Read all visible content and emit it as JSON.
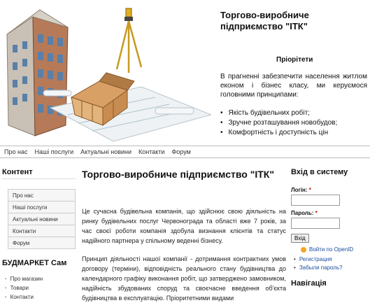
{
  "header": {
    "brand": "Торгово-виробниче підприємство \"ІТК\"",
    "priorities_title": "Пріорітети",
    "priorities_text": "В прагненні забезпечити населення житлом економ і бізнес класу, ми керуємося головними принципами:",
    "priorities": [
      "Якість будівельних робіт;",
      "Зручне розташування новобудов;",
      "Комфортність і доступність цін"
    ]
  },
  "nav": {
    "items": [
      "Про нас",
      "Наші послуги",
      "Актуальні новини",
      "Контакти",
      "Форум"
    ]
  },
  "left": {
    "content_title": "Контент",
    "menu": [
      "Про нас",
      "Наші послуги",
      "Актуальні новини",
      "Контакти",
      "Форум"
    ],
    "shop_title": "БУДМАРКЕТ Сам",
    "shop_items": [
      "Про магазин",
      "Товари",
      "Контакти"
    ]
  },
  "main": {
    "title": "Торгово-виробниче підприємство \"ІТК\"",
    "p1": "Це сучасна будівельна компанія, що здійснює свою діяльність на ринку будівельних послуг Червонограда та області вже 7 років, за час своєї роботи компанія здобула визнання клієнтів та статус надійного партнера у спільному веденні бізнесу.",
    "p2": "Принцип діяльності нашої компанії - дотримання контрактних умов договору (терміни), відповідність реального стану будівництва до календарного графіку виконання робіт, що затверджено замовником, надійність збудованих споруд та своєчасне введення об'єкта будівництва в експлуатацію. Пріоритетними видами"
  },
  "right": {
    "login_title": "Вхід в систему",
    "login_label": "Логін:",
    "password_label": "Пароль:",
    "required_mark": "*",
    "login_button": "Вхід",
    "openid_link": "Войти по OpenID",
    "account_links": [
      "Регистрация",
      "Забыли пароль?"
    ],
    "navigation_title": "Навігація"
  },
  "colors": {
    "link": "#1a4fa0",
    "required": "#cc0000",
    "border": "#bbbbbb"
  }
}
